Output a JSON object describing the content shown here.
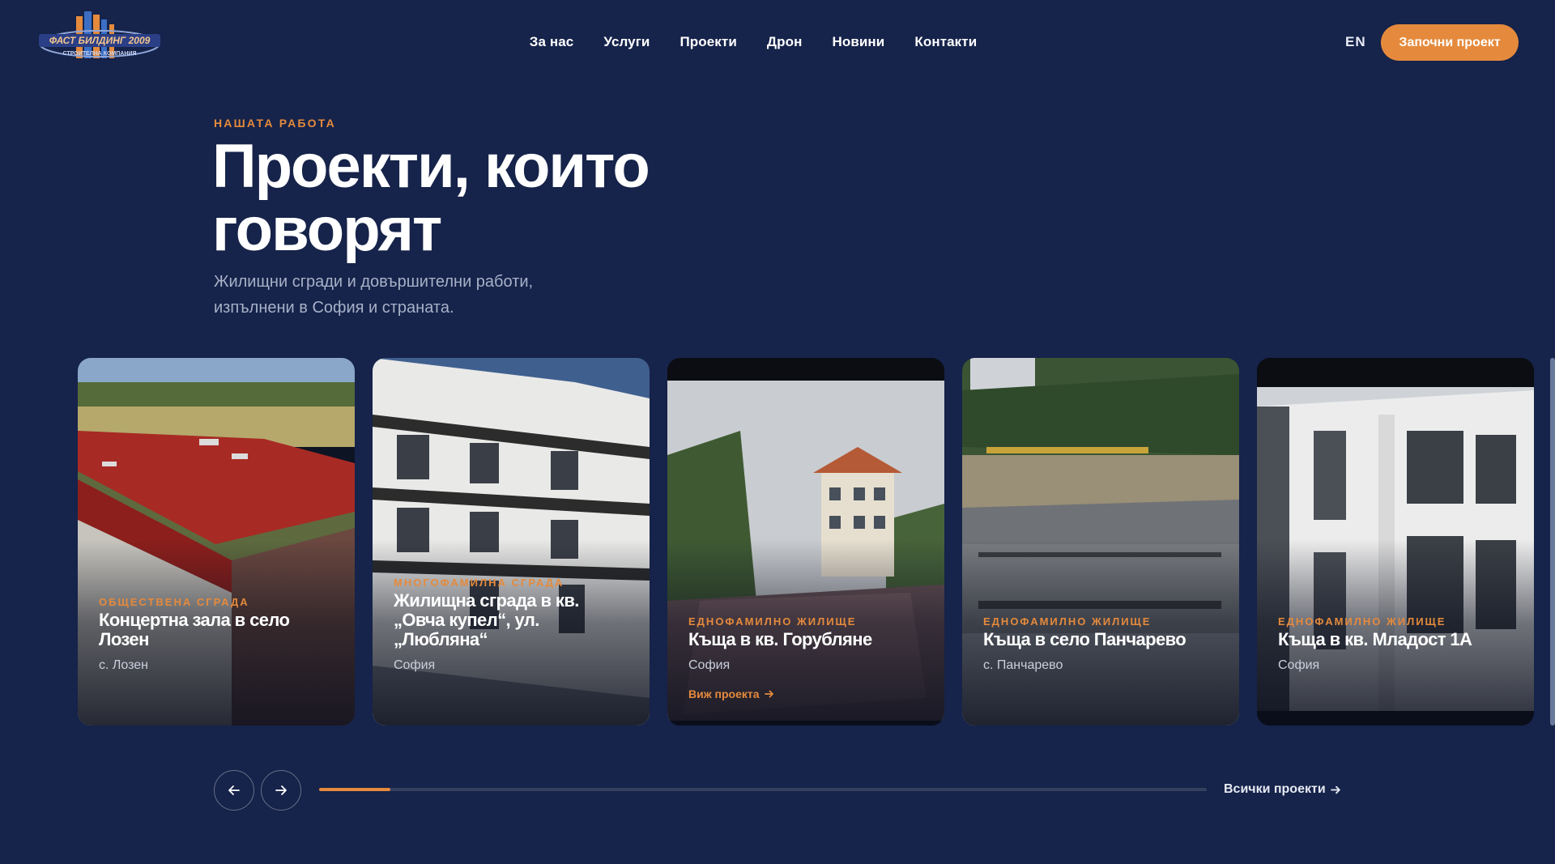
{
  "header": {
    "logo_text": "ФАСТ БИЛДИНГ 2009",
    "logo_subtext": "СТРОИТЕЛНА КОМПАНИЯ",
    "nav": [
      "За нас",
      "Услуги",
      "Проекти",
      "Дрон",
      "Новини",
      "Контакти"
    ],
    "lang": "EN",
    "cta": "Започни проект"
  },
  "hero": {
    "eyebrow": "НАШАТА РАБОТА",
    "title_line1": "Проекти, които",
    "title_line2": "говорят",
    "subtitle_line1": "Жилищни сгради и довършителни работи,",
    "subtitle_line2": "изпълнени в София и страната."
  },
  "projects": [
    {
      "category": "ОБЩЕСТВЕНА СГРАДА",
      "title_line1": "Концертна зала в село",
      "title_line2": "Лозен",
      "location": "с. Лозен",
      "link": ""
    },
    {
      "category": "МНОГОФАМИЛНА СГРАДА",
      "title_line1": "Жилищна сграда в кв.",
      "title_line2": "„Овча купел“, ул.",
      "title_line3": "„Любляна“",
      "location": "София",
      "link": ""
    },
    {
      "category": "ЕДНОФАМИЛНО ЖИЛИЩЕ",
      "title_line1": "Къща в кв. Горубляне",
      "location": "София",
      "link": "Виж проекта"
    },
    {
      "category": "ЕДНОФАМИЛНО ЖИЛИЩЕ",
      "title_line1": "Къща в село Панчарево",
      "location": "с. Панчарево",
      "link": ""
    },
    {
      "category": "ЕДНОФАМИЛНО ЖИЛИЩЕ",
      "title_line1": "Къща в кв. Младост 1А",
      "location": "София",
      "link": ""
    }
  ],
  "carousel": {
    "progress": 0.08,
    "all_projects": "Всички проекти"
  },
  "colors": {
    "background": "#16234a",
    "accent": "#e58a3c",
    "muted_text": "#a8b1c8",
    "track": "#34405e"
  },
  "icons": {
    "prev": "arrow-left-icon",
    "next": "arrow-right-icon",
    "link_arrow": "arrow-right-icon"
  }
}
